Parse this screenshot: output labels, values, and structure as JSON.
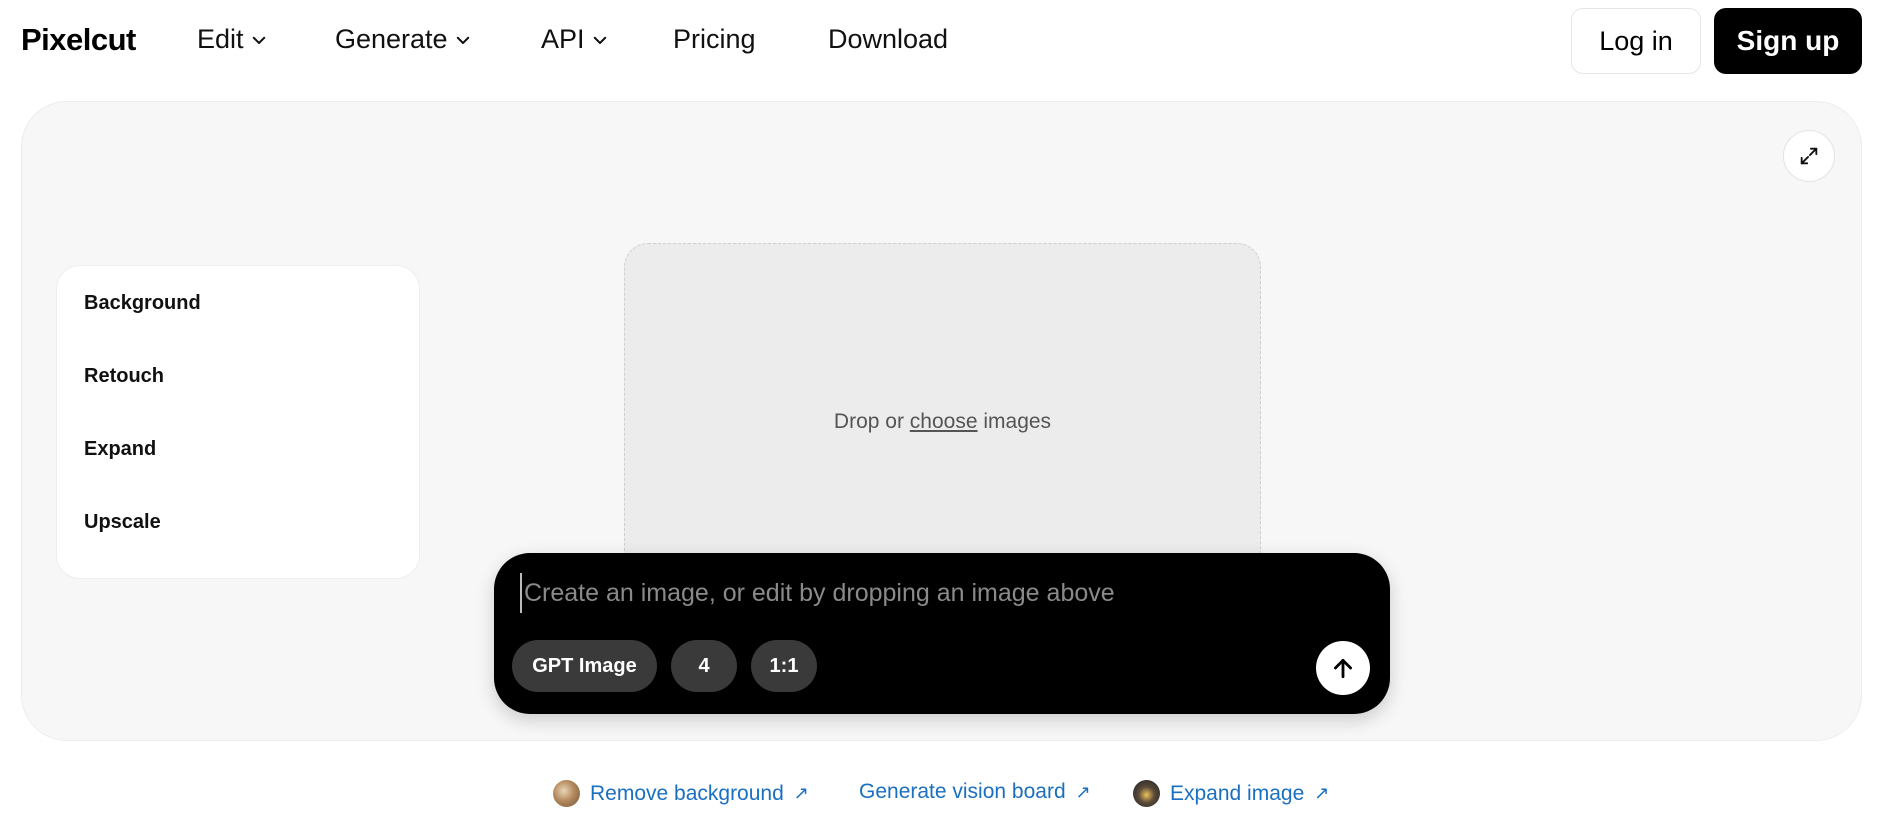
{
  "header": {
    "logo": "Pixelcut",
    "nav": [
      {
        "label": "Edit",
        "dropdown": true
      },
      {
        "label": "Generate",
        "dropdown": true
      },
      {
        "label": "API",
        "dropdown": true
      },
      {
        "label": "Pricing",
        "dropdown": false
      },
      {
        "label": "Download",
        "dropdown": false
      }
    ],
    "login_label": "Log in",
    "signup_label": "Sign up"
  },
  "tools": {
    "items": [
      "Background",
      "Retouch",
      "Expand",
      "Upscale"
    ]
  },
  "dropzone": {
    "prefix": "Drop or",
    "link": "choose",
    "suffix": "images"
  },
  "prompt": {
    "placeholder": "Create an image, or edit by dropping an image above",
    "model": "GPT Image",
    "count": "4",
    "ratio": "1:1"
  },
  "bottom_links": [
    {
      "label": "Remove background",
      "thumb": true
    },
    {
      "label": "Generate vision board",
      "thumb": false
    },
    {
      "label": "Expand image",
      "thumb": true
    }
  ],
  "icons": {
    "expand": "expand-icon",
    "send": "arrow-up-icon",
    "chevron": "chevron-down-icon",
    "external": "arrow-up-right-icon"
  },
  "colors": {
    "accent": "#000000",
    "link": "#1a6fc0",
    "panel_bg": "#f7f7f7"
  }
}
